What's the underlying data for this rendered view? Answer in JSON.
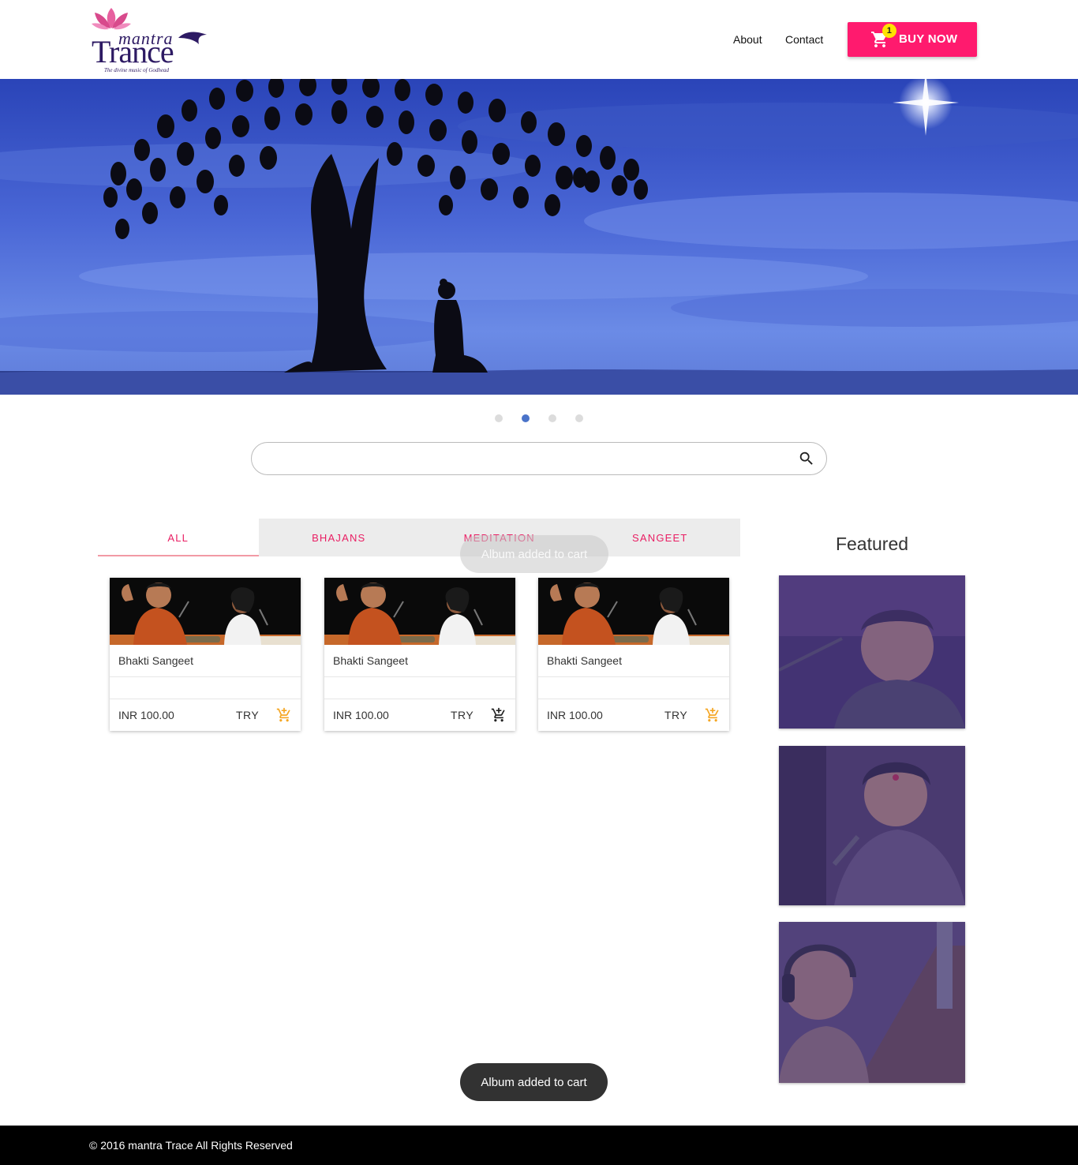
{
  "brand": {
    "logo_word_top": "mantra",
    "logo_word_main": "Trance",
    "logo_tagline": "The divine music of Godhead"
  },
  "nav": {
    "about": "About",
    "contact": "Contact",
    "buy_now": "BUY NOW",
    "cart_count": "1"
  },
  "carousel": {
    "slide_count": 4,
    "active_index": 1
  },
  "search": {
    "placeholder": "",
    "value": ""
  },
  "tabs": [
    {
      "label": "ALL",
      "active": true
    },
    {
      "label": "BHAJANS",
      "active": false
    },
    {
      "label": "MEDITATION",
      "active": false
    },
    {
      "label": "SANGEET",
      "active": false
    }
  ],
  "albums": [
    {
      "title": "Bhakti Sangeet",
      "price": "INR 100.00",
      "try_label": "TRY",
      "in_cart": true
    },
    {
      "title": "Bhakti Sangeet",
      "price": "INR 100.00",
      "try_label": "TRY",
      "in_cart": false
    },
    {
      "title": "Bhakti Sangeet",
      "price": "INR 100.00",
      "try_label": "TRY",
      "in_cart": true
    }
  ],
  "featured": {
    "title": "Featured"
  },
  "toast": {
    "message": "Album added to cart",
    "ghost_message": "Album added to cart"
  },
  "footer": {
    "copyright": "© 2016 mantra Trace All Rights Reserved"
  },
  "colors": {
    "accent_pink": "#ff1a6e",
    "tab_text": "#e91e63",
    "badge_yellow": "#ffe200",
    "cart_icon_orange": "#f5a623",
    "carousel_active": "#4a73c9",
    "featured_overlay": "#4a3a8c"
  },
  "icons": {
    "cart": "cart-icon",
    "search": "search-icon",
    "add_to_cart": "add-shopping-cart-icon"
  }
}
